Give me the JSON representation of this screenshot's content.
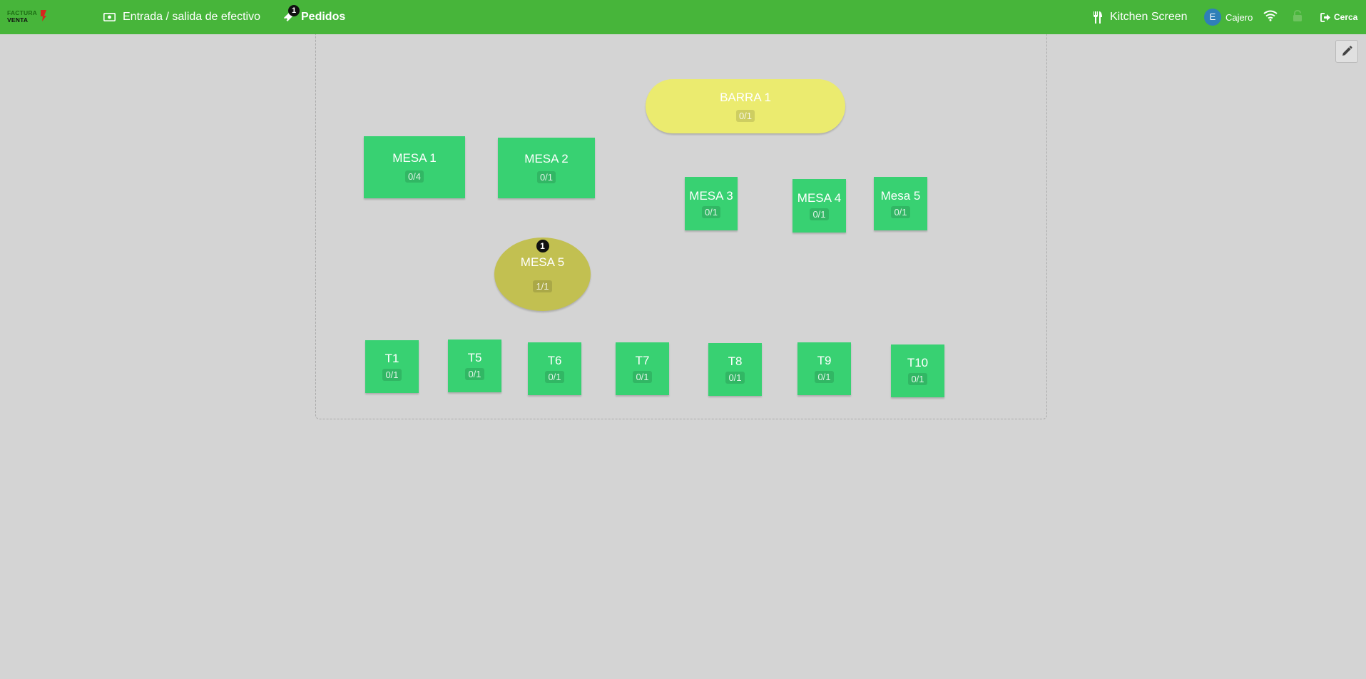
{
  "app": {
    "logo_line1": "FACTURA",
    "logo_line2": "VENTA",
    "colors": {
      "topbar": "#47b53a",
      "free_table": "#38d172",
      "bar": "#ebeb6f",
      "occupied": "#c2c051",
      "background": "#d4d4d4"
    }
  },
  "topbar": {
    "cash_label": "Entrada / salida de efectivo",
    "orders_label": "Pedidos",
    "orders_badge": "1",
    "kitchen_label": "Kitchen Screen",
    "user_initial": "E",
    "user_name": "Cajero",
    "close_label": "Cerca",
    "icons": [
      "cash-icon",
      "orders-icon",
      "utensils-icon",
      "wifi-icon",
      "lock-icon",
      "sign-out-icon",
      "pencil-icon"
    ]
  },
  "tables": [
    {
      "name": "BARRA 1",
      "cap": "0/1",
      "status": "free"
    },
    {
      "name": "MESA 1",
      "cap": "0/4",
      "status": "free"
    },
    {
      "name": "MESA 2",
      "cap": "0/1",
      "status": "free"
    },
    {
      "name": "MESA 3",
      "cap": "0/1",
      "status": "free"
    },
    {
      "name": "MESA 4",
      "cap": "0/1",
      "status": "free"
    },
    {
      "name": "Mesa 5",
      "cap": "0/1",
      "status": "free"
    },
    {
      "name": "MESA 5",
      "cap": "1/1",
      "status": "occupied",
      "badge": "1"
    },
    {
      "name": "T1",
      "cap": "0/1",
      "status": "free"
    },
    {
      "name": "T5",
      "cap": "0/1",
      "status": "free"
    },
    {
      "name": "T6",
      "cap": "0/1",
      "status": "free"
    },
    {
      "name": "T7",
      "cap": "0/1",
      "status": "free"
    },
    {
      "name": "T8",
      "cap": "0/1",
      "status": "free"
    },
    {
      "name": "T9",
      "cap": "0/1",
      "status": "free"
    },
    {
      "name": "T10",
      "cap": "0/1",
      "status": "free"
    }
  ]
}
